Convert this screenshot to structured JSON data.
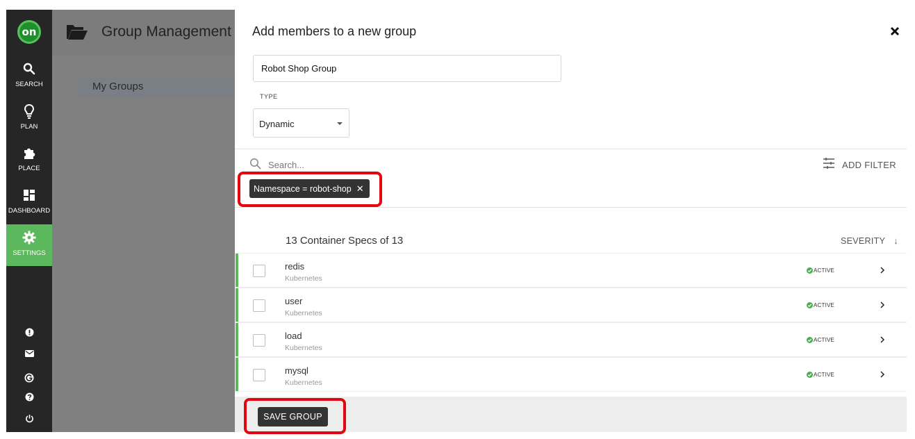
{
  "nav": {
    "logo": "on",
    "items": [
      {
        "label": "SEARCH",
        "icon": "search-icon"
      },
      {
        "label": "PLAN",
        "icon": "lightbulb-icon"
      },
      {
        "label": "PLACE",
        "icon": "puzzle-icon"
      },
      {
        "label": "DASHBOARD",
        "icon": "dashboard-icon"
      },
      {
        "label": "SETTINGS",
        "icon": "gear-icon",
        "active": true
      }
    ],
    "bottom_icons": [
      "alert-icon",
      "mail-icon",
      "g-icon",
      "help-icon",
      "power-icon"
    ],
    "accent_color": "#5cb85c"
  },
  "background_page": {
    "title": "Group Management",
    "tab": "My Groups"
  },
  "panel": {
    "title": "Add members to a new group",
    "name_value": "Robot Shop Group",
    "type_label": "TYPE",
    "type_value": "Dynamic",
    "search_placeholder": "Search...",
    "add_filter_label": "ADD FILTER",
    "filter_chip": "Namespace = robot-shop",
    "list_header": "13 Container Specs of 13",
    "sort_label": "SEVERITY",
    "rows": [
      {
        "name": "redis",
        "type": "Kubernetes",
        "status": "ACTIVE"
      },
      {
        "name": "user",
        "type": "Kubernetes",
        "status": "ACTIVE"
      },
      {
        "name": "load",
        "type": "Kubernetes",
        "status": "ACTIVE"
      },
      {
        "name": "mysql",
        "type": "Kubernetes",
        "status": "ACTIVE"
      }
    ],
    "save_label": "SAVE GROUP"
  },
  "highlight_color": "#e4060e"
}
